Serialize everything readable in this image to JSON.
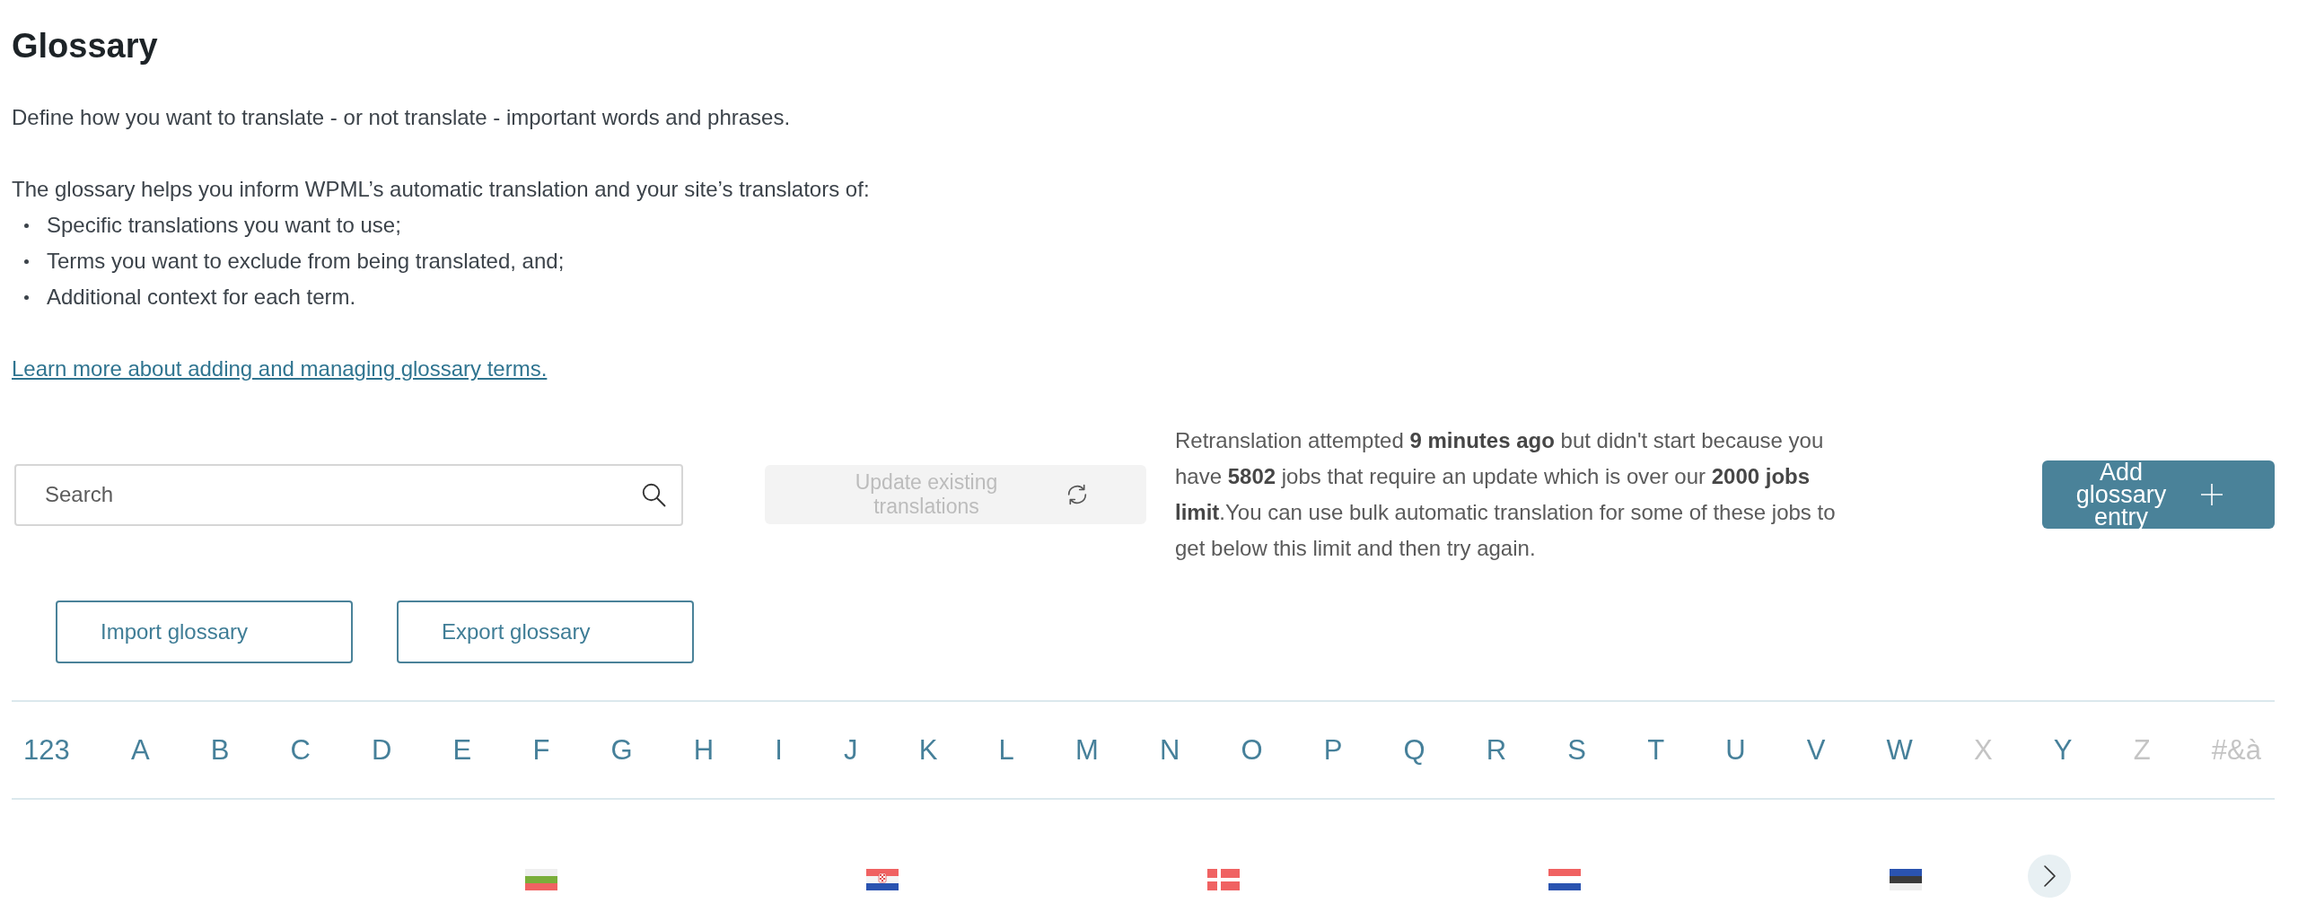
{
  "intro": {
    "title": "Glossary",
    "lead": "Define how you want to translate - or not translate - important words and phrases.",
    "description": "The glossary helps you inform WPML’s automatic translation and your site’s translators of:",
    "bullets": [
      "Specific translations you want to use;",
      "Terms you want to exclude from being translated, and;",
      "Additional context for each term."
    ],
    "link": "Learn more about adding and managing glossary terms."
  },
  "toolbar": {
    "search": {
      "placeholder": "Search"
    },
    "update_button": {
      "label": "Update existing translations",
      "disabled": true
    },
    "notice": "Retranslation attempted **9 minutes ago** but didn't start because you have **5802** jobs that require an update which is over our **2000 jobs limit**.You can use bulk automatic translation for some of these jobs to get below this limit and then try again.",
    "add_button": {
      "label": "Add glossary entry"
    }
  },
  "file_actions": {
    "import_button": {
      "label": "Import glossary"
    },
    "export_button": {
      "label": "Export glossary"
    }
  },
  "alphabet": [
    {
      "label": "123",
      "disabled": false
    },
    {
      "label": "A",
      "disabled": false
    },
    {
      "label": "B",
      "disabled": false
    },
    {
      "label": "C",
      "disabled": false
    },
    {
      "label": "D",
      "disabled": false
    },
    {
      "label": "E",
      "disabled": false
    },
    {
      "label": "F",
      "disabled": false
    },
    {
      "label": "G",
      "disabled": false
    },
    {
      "label": "H",
      "disabled": false
    },
    {
      "label": "I",
      "disabled": false
    },
    {
      "label": "J",
      "disabled": false
    },
    {
      "label": "K",
      "disabled": false
    },
    {
      "label": "L",
      "disabled": false
    },
    {
      "label": "M",
      "disabled": false
    },
    {
      "label": "N",
      "disabled": false
    },
    {
      "label": "O",
      "disabled": false
    },
    {
      "label": "P",
      "disabled": false
    },
    {
      "label": "Q",
      "disabled": false
    },
    {
      "label": "R",
      "disabled": false
    },
    {
      "label": "S",
      "disabled": false
    },
    {
      "label": "T",
      "disabled": false
    },
    {
      "label": "U",
      "disabled": false
    },
    {
      "label": "V",
      "disabled": false
    },
    {
      "label": "W",
      "disabled": false
    },
    {
      "label": "X",
      "disabled": true
    },
    {
      "label": "Y",
      "disabled": false
    },
    {
      "label": "Z",
      "disabled": true
    },
    {
      "label": "#&à",
      "disabled": true
    }
  ],
  "language_columns": [
    {
      "kind": "bulgaria"
    },
    {
      "kind": "croatia"
    },
    {
      "kind": "denmark"
    },
    {
      "kind": "netherlands"
    },
    {
      "kind": "estonia"
    }
  ]
}
